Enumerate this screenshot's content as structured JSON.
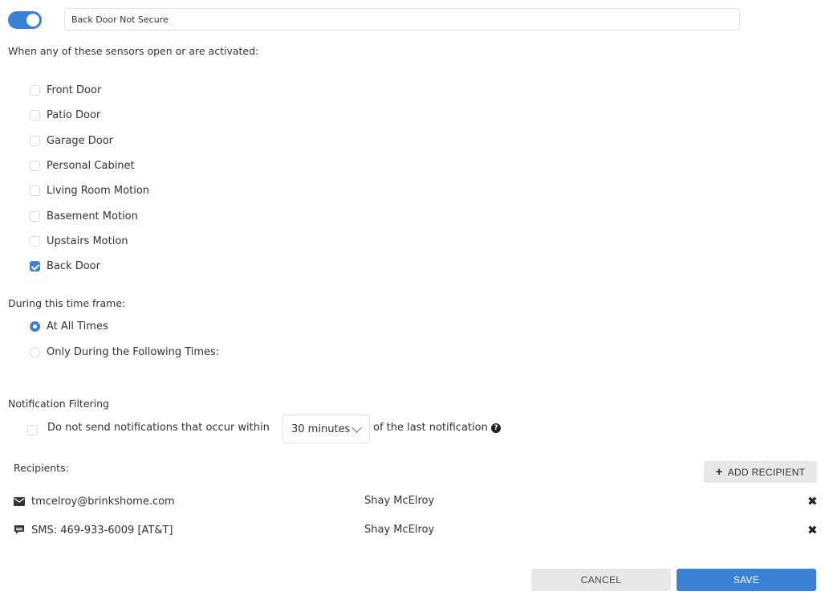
{
  "rule": {
    "enabled": true,
    "name": "Back Door Not Secure"
  },
  "sensors_section": {
    "heading": "When any of these sensors open or are activated:",
    "items": [
      {
        "label": "Front Door",
        "checked": false
      },
      {
        "label": "Patio Door",
        "checked": false
      },
      {
        "label": "Garage Door",
        "checked": false
      },
      {
        "label": "Personal Cabinet",
        "checked": false
      },
      {
        "label": "Living Room Motion",
        "checked": false
      },
      {
        "label": "Basement Motion",
        "checked": false
      },
      {
        "label": "Upstairs Motion",
        "checked": false
      },
      {
        "label": "Back Door",
        "checked": true
      }
    ]
  },
  "timeframe_section": {
    "heading": "During this time frame:",
    "options": [
      {
        "label": "At All Times",
        "selected": true
      },
      {
        "label": "Only During the Following Times:",
        "selected": false
      }
    ]
  },
  "filtering_section": {
    "heading": "Notification Filtering",
    "checked": false,
    "text_before": "Do not send notifications that occur within",
    "interval_value": "30 minutes",
    "text_after": "of the last notification",
    "help_icon": "question-circle-icon"
  },
  "recipients_section": {
    "heading": "Recipients:",
    "add_button_label": "ADD RECIPIENT",
    "items": [
      {
        "icon": "envelope-icon",
        "contact": "tmcelroy@brinkshome.com",
        "name": "Shay McElroy"
      },
      {
        "icon": "sms-comment-icon",
        "contact": "SMS: 469-933-6009 [AT&T]",
        "name": "Shay McElroy"
      }
    ]
  },
  "footer": {
    "cancel_label": "CANCEL",
    "save_label": "SAVE"
  },
  "colors": {
    "accent": "#3b82d6",
    "secondary_button": "#e8e8e8"
  }
}
